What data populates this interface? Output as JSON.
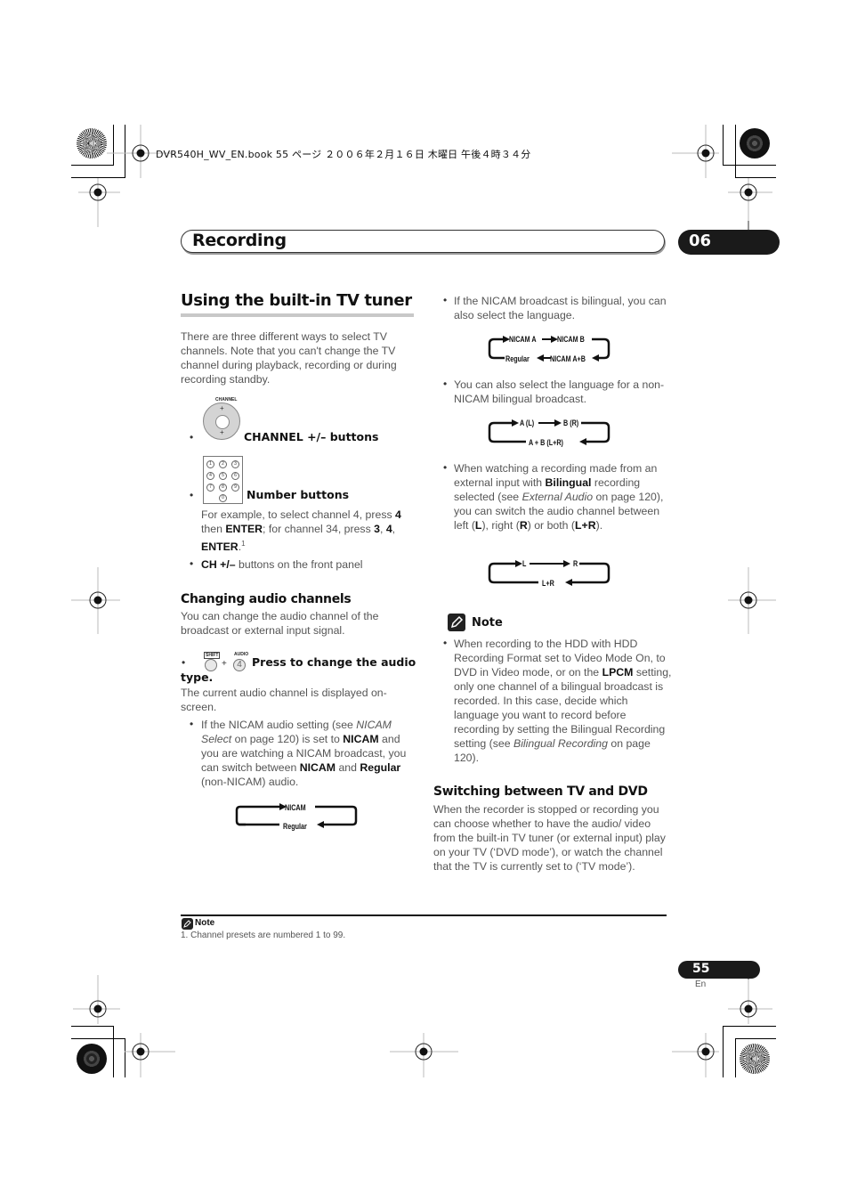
{
  "print_header": "DVR540H_WV_EN.book  55 ページ  ２００６年２月１６日  木曜日  午後４時３４分",
  "chapter": {
    "title": "Recording",
    "number": "06"
  },
  "section": {
    "title": "Using the built-in TV tuner",
    "intro": "There are three different ways to select TV channels. Note that you can't change the TV channel during playback, recording or during recording standby.",
    "methods": [
      {
        "icon": "channel-dial-icon",
        "label": "CHANNEL +/– buttons"
      },
      {
        "icon": "number-keypad-icon",
        "label": "Number buttons"
      }
    ],
    "number_example": {
      "t1": "For example, to select channel 4, press ",
      "b1": "4",
      "t2": " then ",
      "b2": "ENTER",
      "t3": "; for channel 34, press ",
      "b3": "3",
      "t4": ", ",
      "b4": "4",
      "t5": ",",
      "b5": "ENTER",
      "t6": ".",
      "footnote_ref": "1"
    },
    "front_panel": {
      "bold": "CH +/–",
      "text": " buttons on the front panel"
    },
    "keypad_keys": [
      "1",
      "2",
      "3",
      "4",
      "5",
      "6",
      "7",
      "8",
      "9",
      "0"
    ]
  },
  "audio": {
    "title": "Changing audio channels",
    "intro": "You can change the audio channel of the broadcast or external input signal.",
    "press": {
      "shift_label": "SHIFT",
      "audio_label": "AUDIO",
      "key": "4",
      "plus": "+",
      "text1": "Press to change the audio",
      "text2": "type."
    },
    "current": "The current audio channel is displayed on-screen.",
    "nicam_bullet": {
      "t1": "If the NICAM audio setting (see ",
      "i1": "NICAM Select",
      "t2": " on page 120) is set to ",
      "b1": "NICAM",
      "t3": " and you are watching a NICAM broadcast, you can switch between ",
      "b2": "NICAM",
      "t4": " and ",
      "b3": "Regular",
      "t5": " (non-NICAM) audio."
    },
    "diagram1": {
      "top": [
        "NICAM"
      ],
      "bottom": [
        "Regular"
      ]
    }
  },
  "right": {
    "bilingual_nicam": "If the NICAM broadcast is bilingual, you can also select the language.",
    "diagram2": {
      "top": [
        "NICAM A",
        "NICAM B"
      ],
      "bottom": [
        "Regular",
        "NICAM A+B"
      ]
    },
    "non_nicam": "You can also select the language for a non-NICAM bilingual broadcast.",
    "diagram3": {
      "top": [
        "A (L)",
        "B (R)"
      ],
      "bottom": [
        "A + B (L+R)"
      ]
    },
    "external": {
      "t1": "When watching a recording made from an external input with ",
      "b1": "Bilingual",
      "t2": " recording selected (see ",
      "i1": "External Audio",
      "t3": " on page 120), you can switch the audio channel between left (",
      "b2": "L",
      "t4": "), right (",
      "b3": "R",
      "t5": ") or both (",
      "b4": "L+R",
      "t6": ")."
    },
    "diagram4": {
      "top": [
        "L",
        "R"
      ],
      "bottom": [
        "L+R"
      ]
    },
    "note": {
      "heading": "Note",
      "t1": "When recording to the HDD with HDD Recording Format set to Video Mode On, to DVD in Video mode, or on the ",
      "b1": "LPCM",
      "t2": " setting, only one channel of a bilingual broadcast is recorded. In this case, decide which language you want to record before recording by setting the Bilingual Recording setting (see ",
      "i1": "Bilingual Recording",
      "t3": " on page 120)."
    },
    "switching": {
      "title": "Switching between TV and DVD",
      "text": "When the recorder is stopped or recording you can choose whether to have the audio/ video from the built-in TV tuner (or external input) play on your TV (‘DVD mode’), or watch the channel that the TV is currently set to (‘TV mode’)."
    }
  },
  "footer": {
    "note_label": "Note",
    "footnote": "1. Channel presets are numbered 1 to 99.",
    "page_number": "55",
    "language": "En"
  }
}
